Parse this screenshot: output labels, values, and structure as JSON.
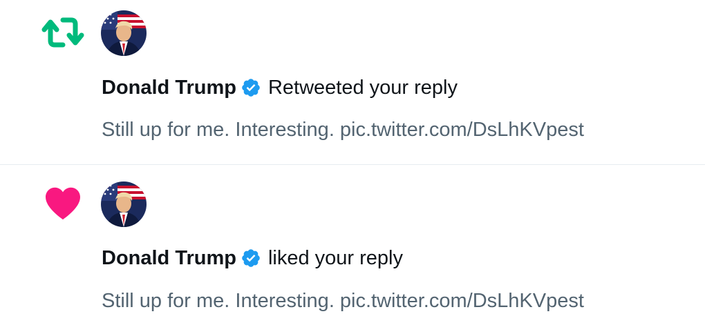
{
  "notifications": [
    {
      "type": "retweet",
      "icon": "retweet-icon",
      "icon_color": "#00ba7c",
      "author": "Donald Trump",
      "verified": true,
      "action": "Retweeted your reply",
      "tweet_text": "Still up for me. Interesting. pic.twitter.com/DsLhKVpest"
    },
    {
      "type": "like",
      "icon": "heart-icon",
      "icon_color": "#f91880",
      "author": "Donald Trump",
      "verified": true,
      "action": "liked your reply",
      "tweet_text": "Still up for me. Interesting. pic.twitter.com/DsLhKVpest"
    }
  ],
  "colors": {
    "verified_badge": "#1d9bf0",
    "primary_text": "#0f1419",
    "secondary_text": "#536471",
    "divider": "#e6ecf0"
  }
}
